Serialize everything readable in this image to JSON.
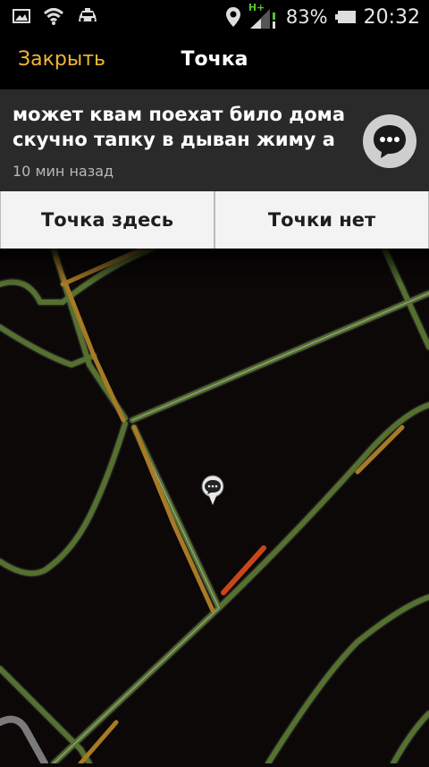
{
  "status_bar": {
    "icons_left": [
      "image-icon",
      "wifi-icon",
      "taxi-icon"
    ],
    "icons_right": [
      "location-icon",
      "signal-icon",
      "battery-icon"
    ],
    "network_type": "H+",
    "battery_percent": "83%",
    "time": "20:32"
  },
  "header": {
    "close_label": "Закрыть",
    "title": "Точка"
  },
  "message": {
    "text": "может квам поехат било дома скучно тапку в дыван жиму а",
    "time_ago": "10 мин назад",
    "icon": "chat-bubble-icon"
  },
  "actions": {
    "point_here": "Точка здесь",
    "no_point": "Точки нет"
  },
  "map": {
    "marker_icon": "chat-marker-icon",
    "colors": {
      "background": "#0b0807",
      "road_green": "#55702f",
      "road_orange": "#a87a26",
      "road_red": "#c9461b",
      "road_gray": "#7a7a7a"
    }
  }
}
